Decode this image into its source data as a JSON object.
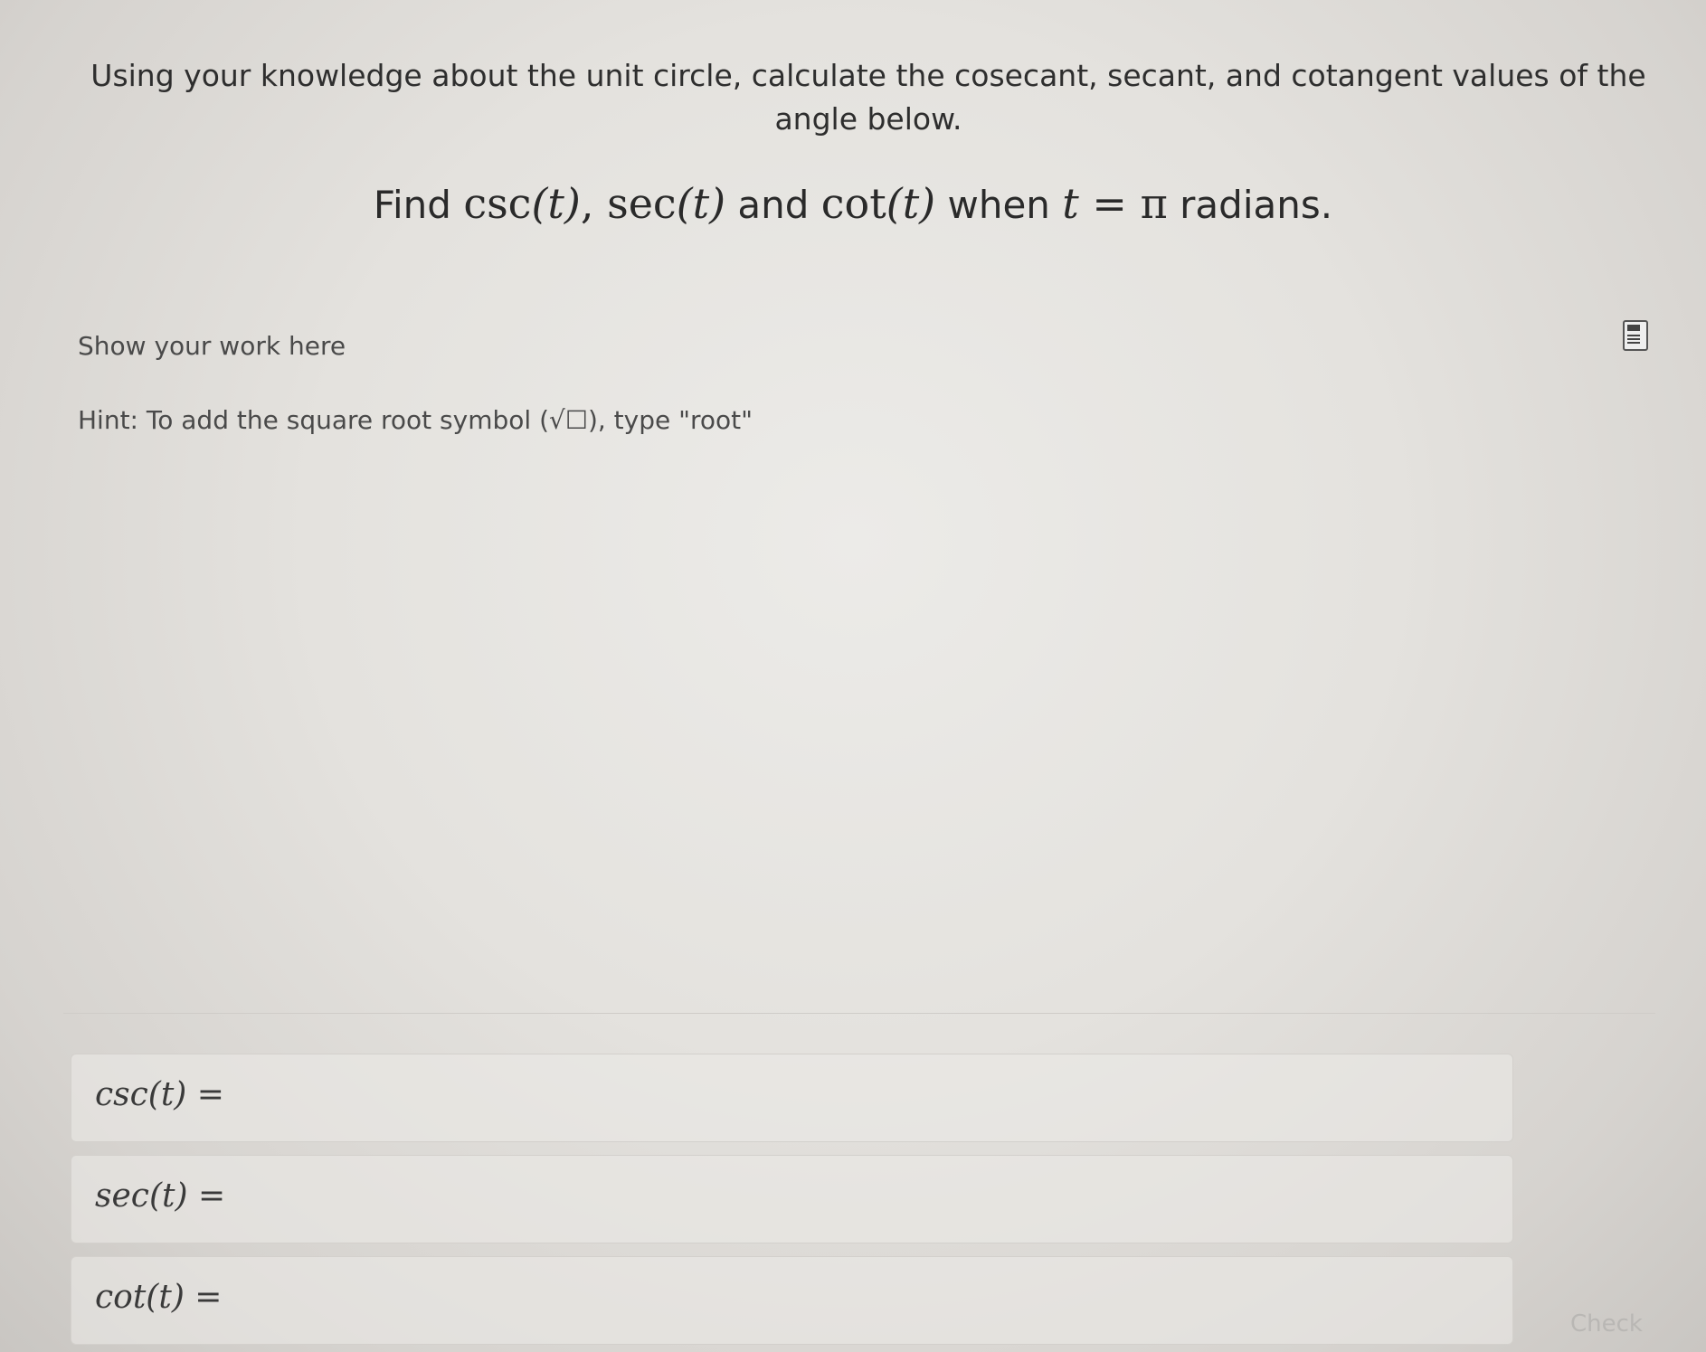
{
  "question": {
    "text": "Using your knowledge about the unit circle, calculate the cosecant, secant, and cotangent values of the angle below."
  },
  "find": {
    "find_word": "Find ",
    "csc": "csc",
    "t1": "(t)",
    "comma1": ", ",
    "sec": "sec",
    "t2": "(t)",
    "and_word": " and ",
    "cot": "cot",
    "t3": "(t)",
    "when_word": " when ",
    "t_var": "t",
    "equals_pi": " = π",
    "radians_word": " radians."
  },
  "work": {
    "label": "Show your work here",
    "calculator_icon": "calculator-icon",
    "hint_prefix": "Hint: To add the square root symbol (",
    "hint_symbol": "√☐",
    "hint_suffix": "), type \"root\""
  },
  "answers": [
    {
      "label": "csc(t) =",
      "value": ""
    },
    {
      "label": "sec(t) =",
      "value": ""
    },
    {
      "label": "cot(t) =",
      "value": ""
    }
  ],
  "check_label": "Check"
}
